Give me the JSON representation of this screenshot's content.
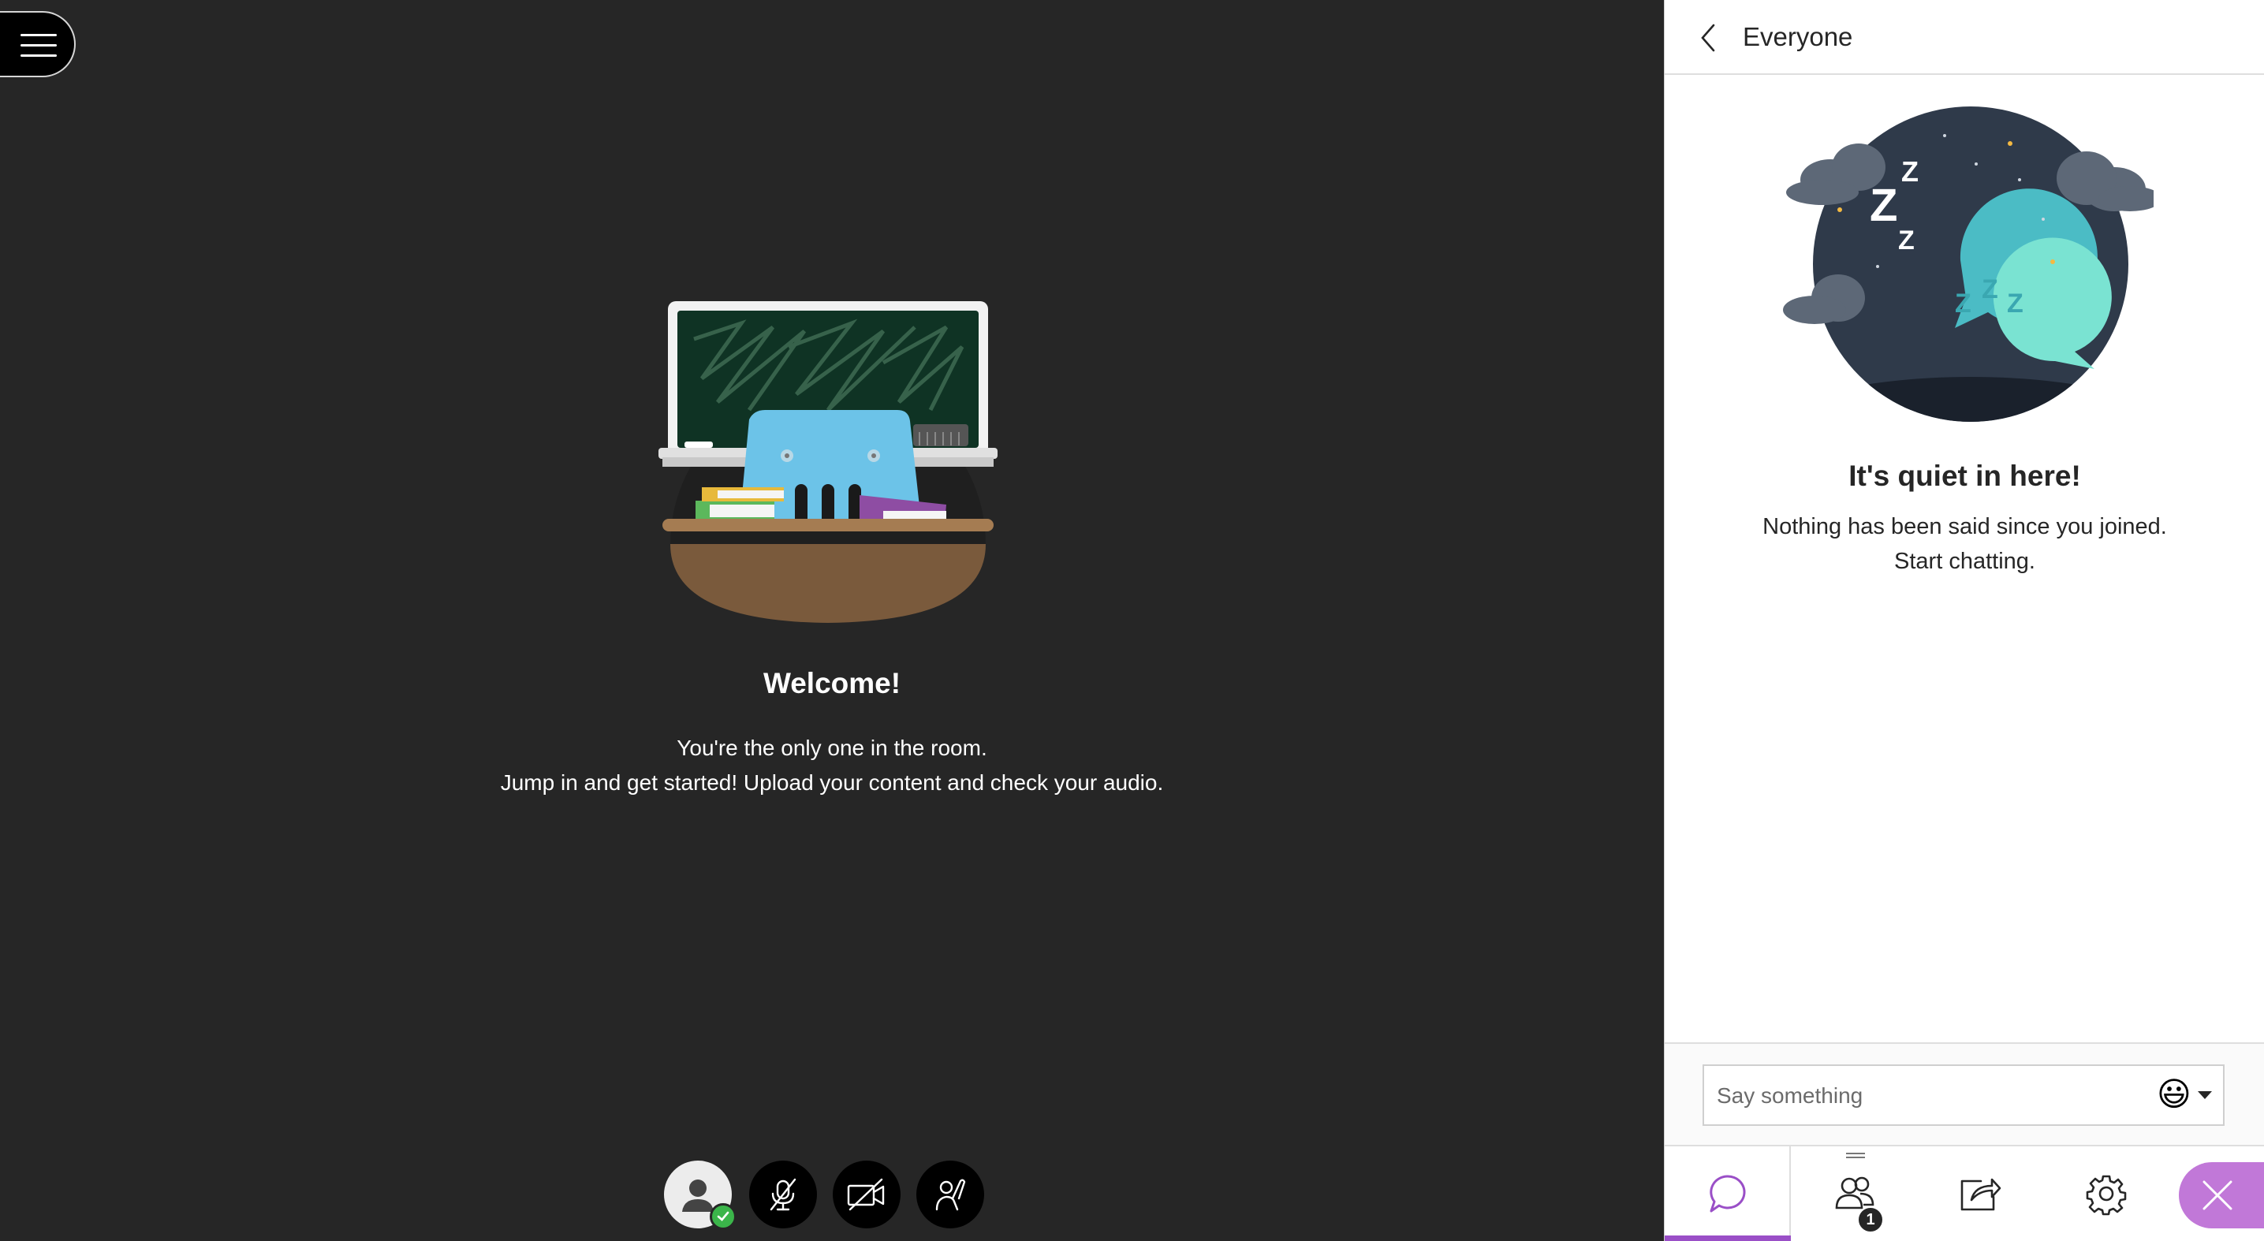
{
  "stage": {
    "welcome_title": "Welcome!",
    "welcome_line_1": "You're the only one in the room.",
    "welcome_line_2": "Jump in and get started! Upload your content and check your audio.",
    "controls": [
      {
        "name": "avatar",
        "icon": "user-avatar-icon",
        "status": "connected"
      },
      {
        "name": "microphone",
        "icon": "microphone-muted-icon"
      },
      {
        "name": "camera",
        "icon": "camera-off-icon"
      },
      {
        "name": "raise-hand",
        "icon": "raise-hand-icon"
      }
    ]
  },
  "panel": {
    "header_title": "Everyone",
    "empty_title": "It's quiet in here!",
    "empty_line_1": "Nothing has been said since you joined.",
    "empty_line_2": "Start chatting.",
    "input_placeholder": "Say something",
    "emoji": "😃",
    "nav": {
      "active_tab": "chat",
      "attendee_count": "1"
    }
  },
  "colors": {
    "stage_bg": "#262626",
    "accent_purple": "#9a4fc7",
    "close_purple": "#c178d8",
    "status_green": "#3bb54a"
  }
}
